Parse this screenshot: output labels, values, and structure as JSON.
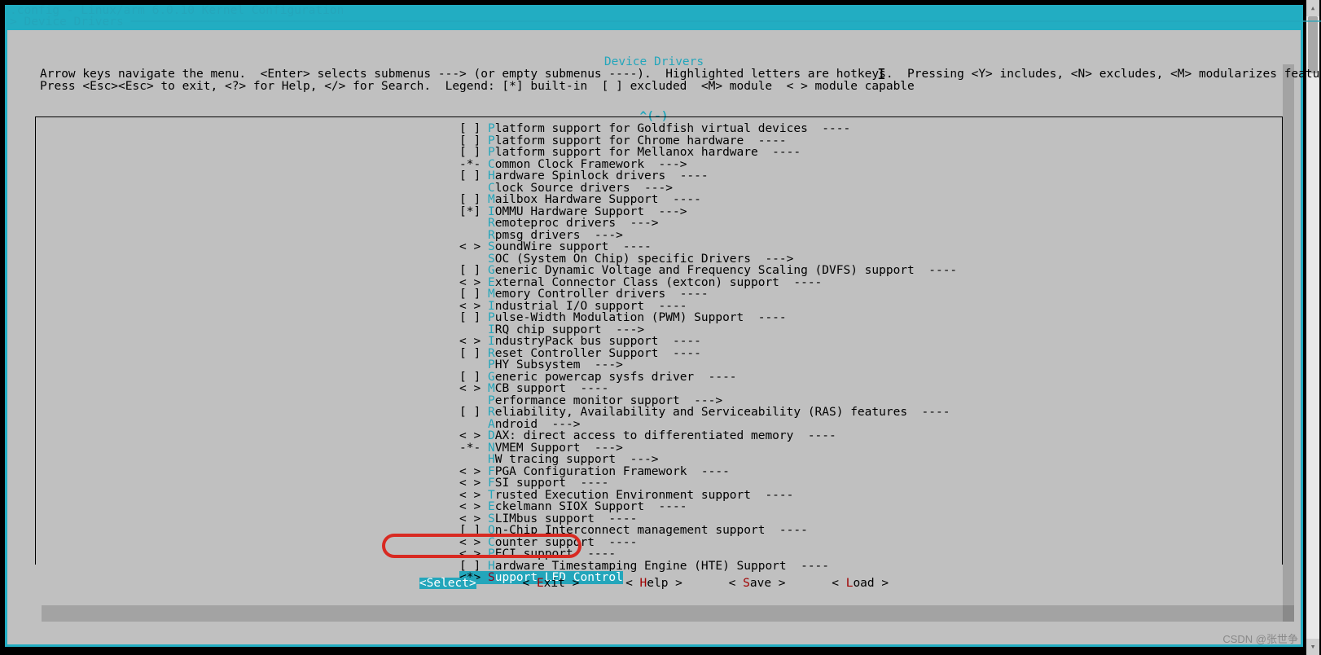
{
  "window_title": ".config - Linux/arm 6.0.10 Kernel Configuration",
  "breadcrumb": "> Device Drivers ────────────────────────────────────────────────────────────────────────────────────────────────────────────────────────────────────────────────────────────────────────────────────────────",
  "menu_title": "Device Drivers",
  "instr_line1": "Arrow keys navigate the menu.  <Enter> selects submenus ---> (or empty submenus ----).  Highlighted letters are hotkeys.  Pressing <Y> includes, <N> excludes, <M> modularizes features.",
  "instr_line2": "Press <Esc><Esc> to exit, <?> for Help, </> for Search.  Legend: [*] built-in  [ ] excluded  <M> module  < > module capable",
  "scroll_indicator": "^(-)",
  "padding": "                                                           ",
  "menu": [
    {
      "prefix": "[ ] ",
      "hk": "P",
      "rest": "latform support for Goldfish virtual devices  ----"
    },
    {
      "prefix": "[ ] ",
      "hk": "P",
      "rest": "latform support for Chrome hardware  ----"
    },
    {
      "prefix": "[ ] ",
      "hk": "P",
      "rest": "latform support for Mellanox hardware  ----"
    },
    {
      "prefix": "-*- ",
      "hk": "C",
      "rest": "ommon Clock Framework  --->"
    },
    {
      "prefix": "[ ] ",
      "hk": "H",
      "rest": "ardware Spinlock drivers  ----"
    },
    {
      "prefix": "    ",
      "hk": "C",
      "rest": "lock Source drivers  --->"
    },
    {
      "prefix": "[ ] ",
      "hk": "M",
      "rest": "ailbox Hardware Support  ----"
    },
    {
      "prefix": "[*] ",
      "hk": "I",
      "rest": "OMMU Hardware Support  --->"
    },
    {
      "prefix": "    ",
      "hk": "R",
      "rest": "emoteproc drivers  --->"
    },
    {
      "prefix": "    ",
      "hk": "R",
      "rest": "pmsg drivers  --->"
    },
    {
      "prefix": "< > ",
      "hk": "S",
      "rest": "oundWire support  ----"
    },
    {
      "prefix": "    ",
      "hk": "S",
      "rest": "OC (System On Chip) specific Drivers  --->"
    },
    {
      "prefix": "[ ] ",
      "hk": "G",
      "rest": "eneric Dynamic Voltage and Frequency Scaling (DVFS) support  ----"
    },
    {
      "prefix": "< > ",
      "hk": "E",
      "rest": "xternal Connector Class (extcon) support  ----"
    },
    {
      "prefix": "[ ] ",
      "hk": "M",
      "rest": "emory Controller drivers  ----"
    },
    {
      "prefix": "< > ",
      "hk": "I",
      "rest": "ndustrial I/O support  ----"
    },
    {
      "prefix": "[ ] ",
      "hk": "P",
      "rest": "ulse-Width Modulation (PWM) Support  ----"
    },
    {
      "prefix": "    ",
      "hk": "I",
      "rest": "RQ chip support  --->"
    },
    {
      "prefix": "< > ",
      "hk": "I",
      "rest": "ndustryPack bus support  ----"
    },
    {
      "prefix": "[ ] ",
      "hk": "R",
      "rest": "eset Controller Support  ----"
    },
    {
      "prefix": "    ",
      "hk": "P",
      "rest": "HY Subsystem  --->"
    },
    {
      "prefix": "[ ] ",
      "hk": "G",
      "rest": "eneric powercap sysfs driver  ----"
    },
    {
      "prefix": "< > ",
      "hk": "M",
      "rest": "CB support  ----"
    },
    {
      "prefix": "    ",
      "hk": "P",
      "rest": "erformance monitor support  --->"
    },
    {
      "prefix": "[ ] ",
      "hk": "R",
      "rest": "eliability, Availability and Serviceability (RAS) features  ----"
    },
    {
      "prefix": "    ",
      "hk": "A",
      "rest": "ndroid  --->"
    },
    {
      "prefix": "< > ",
      "hk": "D",
      "rest": "AX: direct access to differentiated memory  ----"
    },
    {
      "prefix": "-*- ",
      "hk": "N",
      "rest": "VMEM Support  --->"
    },
    {
      "prefix": "    ",
      "hk": "H",
      "rest": "W tracing support  --->"
    },
    {
      "prefix": "< > ",
      "hk": "F",
      "rest": "PGA Configuration Framework  ----"
    },
    {
      "prefix": "< > ",
      "hk": "F",
      "rest": "SI support  ----"
    },
    {
      "prefix": "< > ",
      "hk": "T",
      "rest": "rusted Execution Environment support  ----"
    },
    {
      "prefix": "< > ",
      "hk": "E",
      "rest": "ckelmann SIOX Support  ----"
    },
    {
      "prefix": "< > ",
      "hk": "S",
      "rest": "LIMbus support  ----"
    },
    {
      "prefix": "[ ] ",
      "hk": "O",
      "rest": "n-Chip Interconnect management support  ----"
    },
    {
      "prefix": "< > ",
      "hk": "C",
      "rest": "ounter support  ----"
    },
    {
      "prefix": "< > ",
      "hk": "P",
      "rest": "ECI support  ----"
    },
    {
      "prefix": "[ ] ",
      "hk": "H",
      "rest": "ardware Timestamping Engine (HTE) Support  ----"
    }
  ],
  "selected": {
    "prefix": "<*>",
    "spacer": " ",
    "hk": "S",
    "rest": "upport LED Control"
  },
  "buttons": {
    "select": "Select",
    "exit": "Exit",
    "help": "Help",
    "save": "Save",
    "load": "Load"
  },
  "watermark": "CSDN @张世争"
}
